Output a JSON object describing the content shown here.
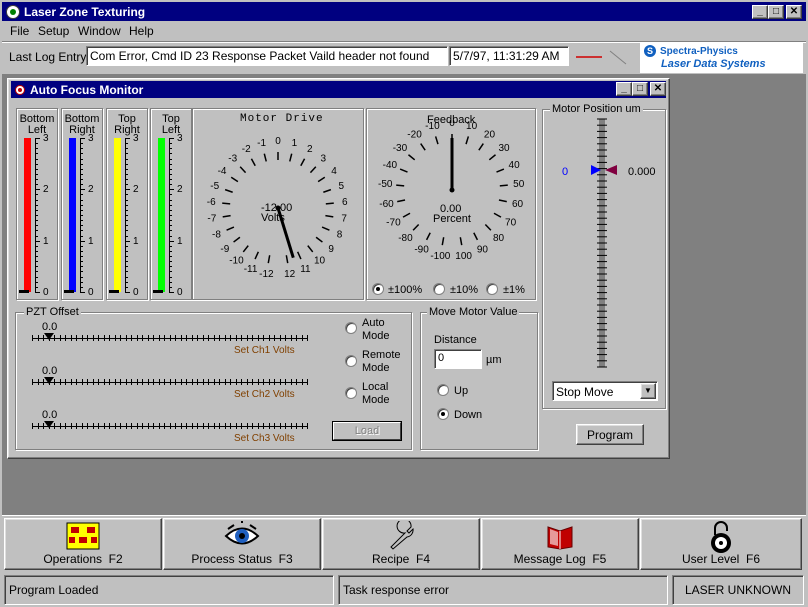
{
  "app": {
    "title": "Laser Zone Texturing",
    "minimize": "_",
    "maximize": "□",
    "close": "✕"
  },
  "menu": {
    "file": "File",
    "setup": "Setup",
    "window": "Window",
    "help": "Help"
  },
  "log": {
    "label": "Last Log Entry",
    "message": "Com Error, Cmd ID 23 Response Packet Vaild header not found",
    "timestamp": "5/7/97, 11:31:29 AM"
  },
  "brand": {
    "line1": "Spectra-Physics",
    "line2": "Laser Data Systems",
    "logo_icon": "spectra-physics-logo"
  },
  "afm": {
    "title": "Auto Focus Monitor",
    "bars": [
      {
        "label1": "Bottom",
        "label2": "Left",
        "color": "#ff0000",
        "fill": 1.0
      },
      {
        "label1": "Bottom",
        "label2": "Right",
        "color": "#0000ff",
        "fill": 1.0
      },
      {
        "label1": "Top",
        "label2": "Right",
        "color": "#ffff00",
        "fill": 1.0
      },
      {
        "label1": "Top",
        "label2": "Left",
        "color": "#00ff00",
        "fill": 1.0
      }
    ],
    "bar_scale": [
      "3",
      "2",
      "1",
      "0"
    ],
    "motor_drive": {
      "title": "Motor Drive",
      "value": "-12.00",
      "unit": "Volts",
      "needle_value": 11.5,
      "ticks": [
        "-12",
        "-11",
        "-10",
        "-9",
        "-8",
        "-7",
        "-6",
        "-5",
        "-4",
        "-3",
        "-2",
        "-1",
        "0",
        "1",
        "2",
        "3",
        "4",
        "5",
        "6",
        "7",
        "8",
        "9",
        "10",
        "11",
        "12"
      ]
    },
    "feedback": {
      "title": "Feedback",
      "value": "0.00",
      "unit": "Percent",
      "needle_value": 0,
      "ticks": [
        "-100",
        "-90",
        "-80",
        "-70",
        "-60",
        "-50",
        "-40",
        "-30",
        "-20",
        "-10",
        "0",
        "10",
        "20",
        "30",
        "40",
        "50",
        "60",
        "70",
        "80",
        "90",
        "100"
      ],
      "ranges": [
        {
          "label": "±100%",
          "selected": true
        },
        {
          "label": "±10%",
          "selected": false
        },
        {
          "label": "±1%",
          "selected": false
        }
      ]
    },
    "motor_position": {
      "title": "Motor Position um",
      "left_value": "0",
      "right_value": "0.000",
      "stop_move": "Stop Move",
      "program": "Program"
    },
    "pzt": {
      "title": "PZT Offset",
      "channels": [
        {
          "value": "0.0",
          "label": "Set Ch1 Volts"
        },
        {
          "value": "0.0",
          "label": "Set Ch2 Volts"
        },
        {
          "value": "0.0",
          "label": "Set Ch3 Volts"
        }
      ],
      "modes": [
        {
          "line1": "Auto",
          "line2": "Mode"
        },
        {
          "line1": "Remote",
          "line2": "Mode"
        },
        {
          "line1": "Local",
          "line2": "Mode"
        }
      ],
      "load": "Load"
    },
    "move_motor": {
      "title": "Move Motor Value",
      "distance_label": "Distance",
      "distance_value": "0",
      "unit": "µm",
      "up": "Up",
      "down": "Down"
    }
  },
  "fkeys": [
    {
      "label": "Operations  F2",
      "icon": "operations-icon"
    },
    {
      "label": "Process Status  F3",
      "icon": "eye-icon"
    },
    {
      "label": "Recipe  F4",
      "icon": "wrench-icon"
    },
    {
      "label": "Message Log  F5",
      "icon": "book-icon"
    },
    {
      "label": "User Level  F6",
      "icon": "lock-icon"
    }
  ],
  "status": {
    "left": "Program Loaded",
    "middle": "Task response error",
    "right": "LASER UNKNOWN"
  }
}
